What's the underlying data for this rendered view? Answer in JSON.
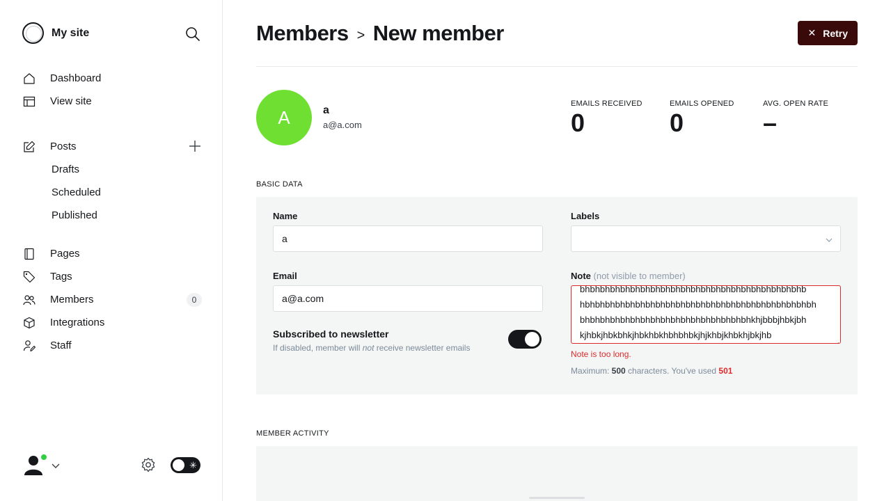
{
  "site": {
    "name": "My site"
  },
  "nav": {
    "dashboard": "Dashboard",
    "view_site": "View site",
    "posts": "Posts",
    "drafts": "Drafts",
    "scheduled": "Scheduled",
    "published": "Published",
    "pages": "Pages",
    "tags": "Tags",
    "members": "Members",
    "members_count": "0",
    "integrations": "Integrations",
    "staff": "Staff"
  },
  "header": {
    "crumb_parent": "Members",
    "crumb_separator": ">",
    "crumb_current": "New member",
    "retry_label": "Retry"
  },
  "member": {
    "avatar_letter": "A",
    "name": "a",
    "email": "a@a.com",
    "avatar_color": "#6fe032"
  },
  "stats": [
    {
      "label": "EMAILS RECEIVED",
      "value": "0"
    },
    {
      "label": "EMAILS OPENED",
      "value": "0"
    },
    {
      "label": "AVG. OPEN RATE",
      "value": "–"
    }
  ],
  "basic_data": {
    "section_title": "BASIC DATA",
    "name_label": "Name",
    "name_value": "a",
    "email_label": "Email",
    "email_value": "a@a.com",
    "labels_label": "Labels",
    "labels_value": "",
    "note_label": "Note",
    "note_hint": "(not visible to member)",
    "note_lines": [
      "bhbhbhbhbhbhbhbhbhbhbhbhbhbhbhbhbhbhbhbhbhbhb",
      "hbhbhbhbhbhbhbhbhbhbhbhbhbhbhbhbhbhbhbhbhbhbhbh",
      "bhbhbhbhbhbhbhbhbhbhbhbhbhbhbhbhbhkhjbbbjhbkjbh",
      "kjhbkjhbkbhkjhbkhbkhbhbhbkjhjkhbjkhbkhjbkjhb"
    ],
    "note_error": "Note is too long.",
    "count_prefix": "Maximum: ",
    "count_max": "500",
    "count_mid": " characters. You've used ",
    "count_used": "501",
    "subscribed_title": "Subscribed to newsletter",
    "subscribed_desc_1": "If disabled, member will ",
    "subscribed_desc_em": "not",
    "subscribed_desc_2": " receive newsletter emails",
    "subscribed_on": true
  },
  "activity": {
    "section_title": "MEMBER ACTIVITY"
  },
  "colors": {
    "accent_dark": "#3a0a0a",
    "error": "#e02a2a",
    "online": "#30cf43"
  },
  "icons": [
    "search-icon",
    "home-icon",
    "view-site-icon",
    "edit-post-icon",
    "plus-icon",
    "page-icon",
    "tag-icon",
    "members-icon",
    "integrations-icon",
    "staff-icon",
    "user-avatar-icon",
    "chevron-down-icon",
    "gear-icon",
    "sun-icon",
    "close-icon"
  ]
}
